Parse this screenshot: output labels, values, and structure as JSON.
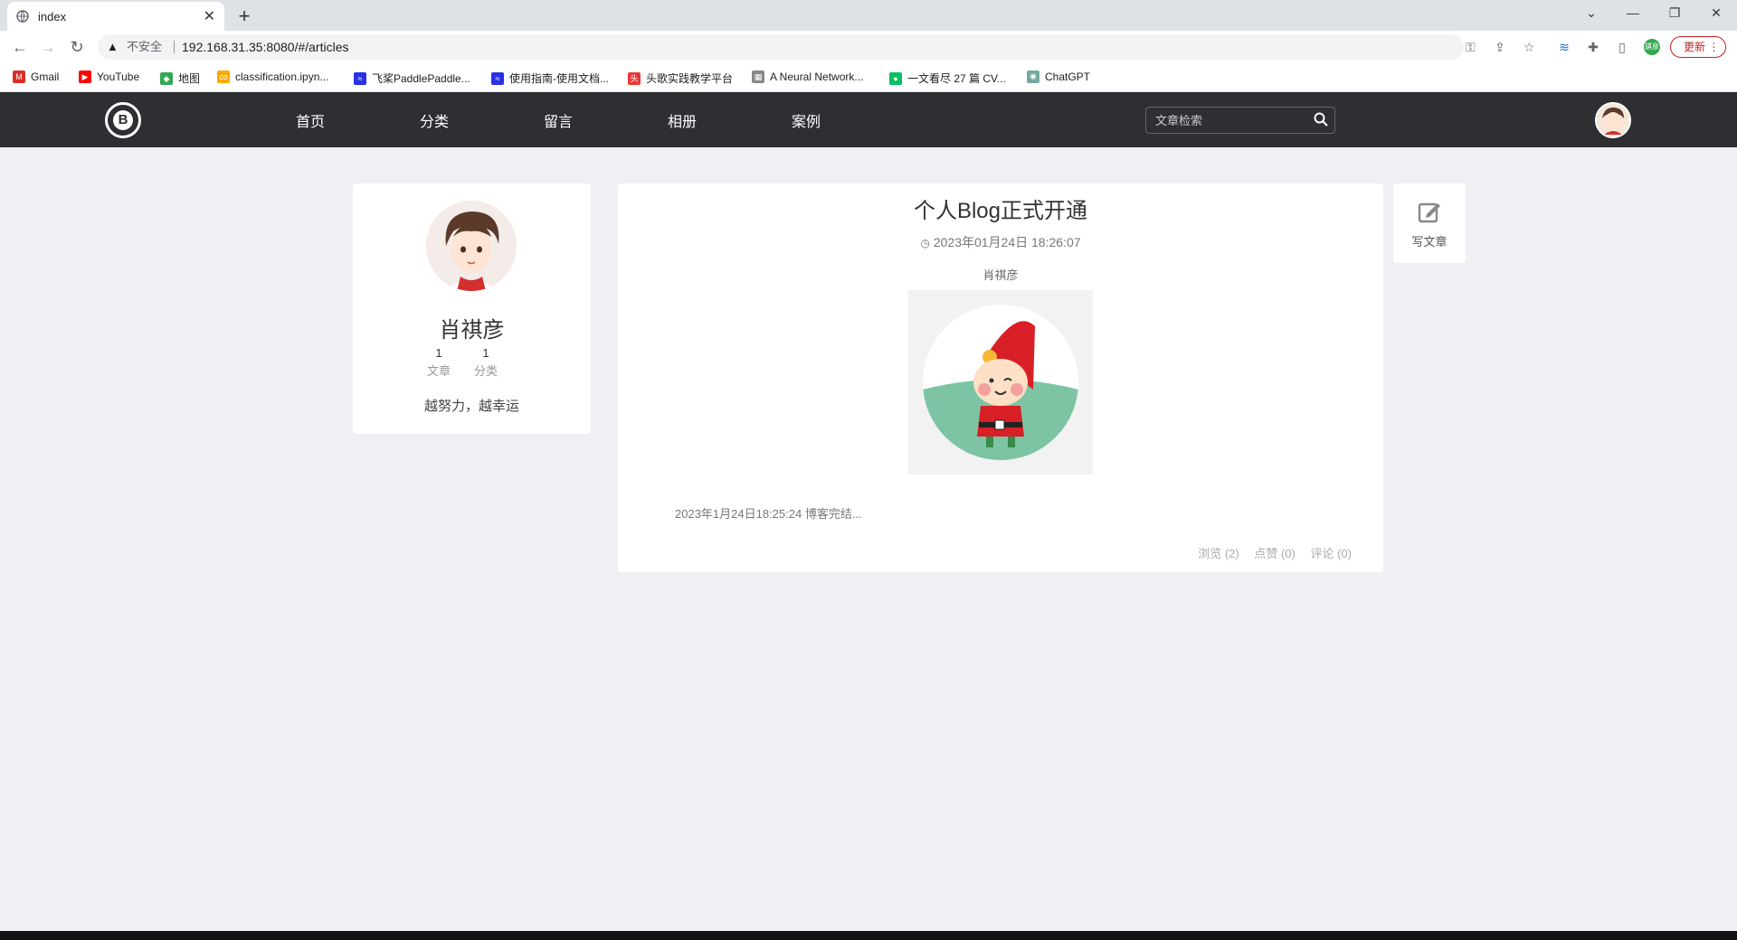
{
  "browser": {
    "tab_title": "index",
    "tab_close": "✕",
    "new_tab": "+",
    "not_secure": "不安全",
    "url": "192.168.31.35:8080/#/articles",
    "update_label": "更新",
    "profile_chip": "骐彦"
  },
  "bookmarks": [
    {
      "label": "Gmail",
      "color": "#d93025",
      "glyph": "M"
    },
    {
      "label": "YouTube",
      "color": "#ff0000",
      "glyph": "▶"
    },
    {
      "label": "地图",
      "color": "#34a853",
      "glyph": "◆"
    },
    {
      "label": "classification.ipyn...",
      "color": "#f9ab00",
      "glyph": "co"
    },
    {
      "label": "飞桨PaddlePaddle...",
      "color": "#2932e1",
      "glyph": "≈"
    },
    {
      "label": "使用指南-使用文档...",
      "color": "#2932e1",
      "glyph": "≈"
    },
    {
      "label": "头歌实践教学平台",
      "color": "#e53935",
      "glyph": "头"
    },
    {
      "label": "A Neural Network...",
      "color": "#888888",
      "glyph": "▦"
    },
    {
      "label": "一文看尽 27 篇 CV...",
      "color": "#07c160",
      "glyph": "●"
    },
    {
      "label": "ChatGPT",
      "color": "#74aa9c",
      "glyph": "✺"
    }
  ],
  "site": {
    "logo_letter": "B",
    "nav": [
      "首页",
      "分类",
      "留言",
      "相册",
      "案例"
    ],
    "search_placeholder": "文章检索"
  },
  "profile": {
    "name": "肖祺彦",
    "stats": [
      {
        "num": "1",
        "label": "文章"
      },
      {
        "num": "1",
        "label": "分类"
      }
    ],
    "motto": "越努力，越幸运"
  },
  "article": {
    "title": "个人Blog正式开通",
    "date": "2023年01月24日 18:26:07",
    "author": "肖祺彦",
    "excerpt": "2023年1月24日18:25:24 博客完结...",
    "views": "浏览 (2)",
    "likes": "点赞 (0)",
    "comments": "评论 (0)"
  },
  "write": {
    "label": "写文章"
  }
}
